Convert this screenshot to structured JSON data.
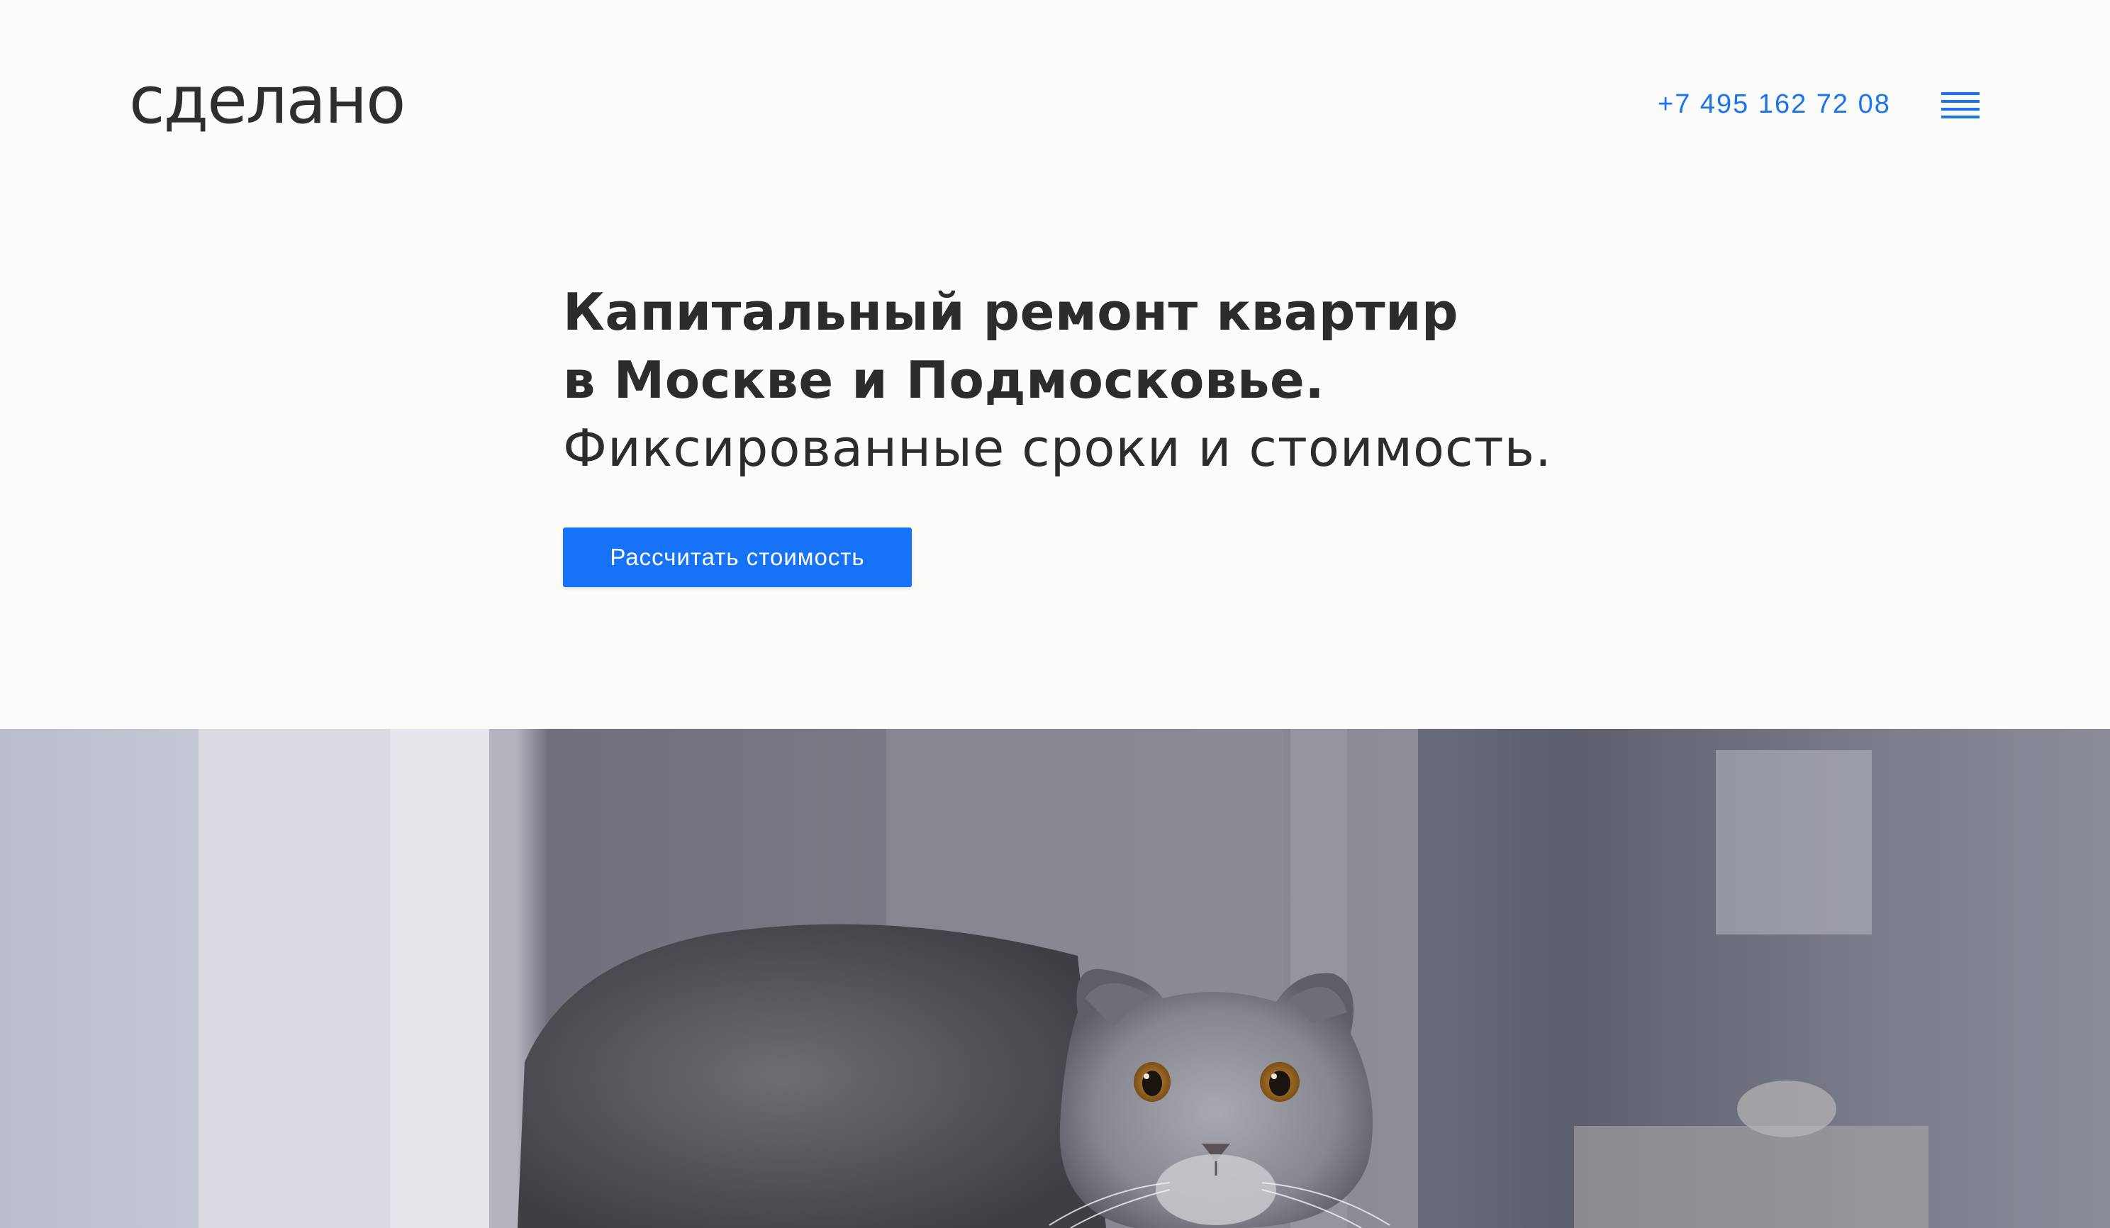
{
  "header": {
    "logo": "сделано",
    "phone": "+7 495 162 72 08",
    "menu_icon": "hamburger-menu-icon",
    "accent_color": "#1a73f0"
  },
  "hero": {
    "headline_line1": "Капитальный ремонт квартир",
    "headline_line2": "в Москве и Подмосковье.",
    "subline": "Фиксированные сроки и стоимость.",
    "cta_label": "Рассчитать стоимость",
    "cta_color": "#1673f7",
    "image": "cat-in-apartment-photo"
  }
}
